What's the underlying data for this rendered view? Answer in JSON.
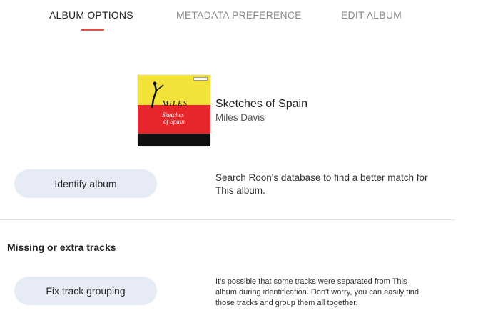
{
  "tabs": [
    {
      "label": "ALBUM OPTIONS",
      "active": true
    },
    {
      "label": "METADATA PREFERENCE",
      "active": false
    },
    {
      "label": "EDIT ALBUM",
      "active": false
    }
  ],
  "accent_color": "#d9534a",
  "album": {
    "title": "Sketches of Spain",
    "artist": "Miles Davis",
    "cover_text": {
      "artist": "MILES",
      "title_line1": "Sketches",
      "title_line2": "of Spain"
    }
  },
  "identify": {
    "button_label": "Identify album",
    "description": "Search Roon's database to find a better match for This album."
  },
  "missing_section": {
    "heading": "Missing or extra tracks",
    "button_label": "Fix track grouping",
    "description": "It's possible that some tracks were separated from This album during identification. Don't worry, you can easily find those tracks and group them all together."
  }
}
